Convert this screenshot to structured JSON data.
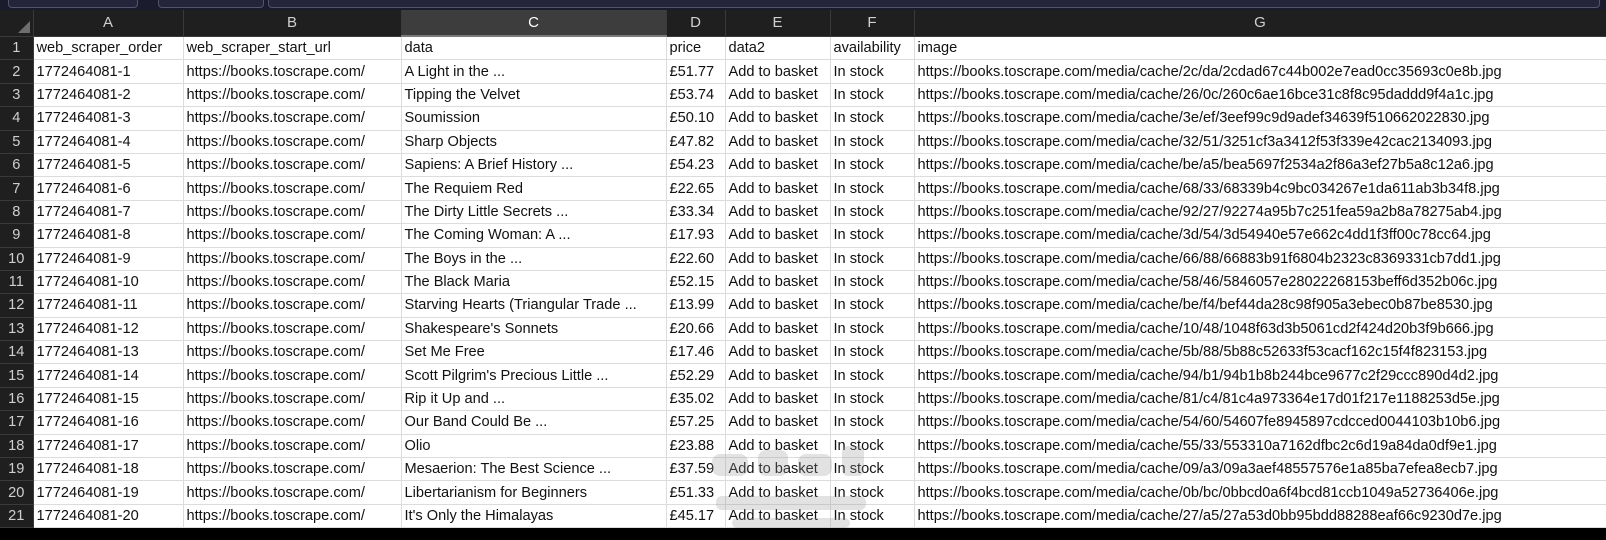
{
  "sheet": {
    "column_letters": [
      "A",
      "B",
      "C",
      "D",
      "E",
      "F",
      "G"
    ],
    "selected_column": "C",
    "header_row": {
      "number": "1",
      "cells": [
        "web_scraper_order",
        "web_scraper_start_url",
        "data",
        "price",
        "data2",
        "availability",
        "image"
      ]
    },
    "rows": [
      {
        "n": "2",
        "cells": [
          "1772464081-1",
          "https://books.toscrape.com/",
          "A Light in the ...",
          "£51.77",
          "Add to basket",
          "In stock",
          "https://books.toscrape.com/media/cache/2c/da/2cdad67c44b002e7ead0cc35693c0e8b.jpg"
        ]
      },
      {
        "n": "3",
        "cells": [
          "1772464081-2",
          "https://books.toscrape.com/",
          "Tipping the Velvet",
          "£53.74",
          "Add to basket",
          "In stock",
          "https://books.toscrape.com/media/cache/26/0c/260c6ae16bce31c8f8c95daddd9f4a1c.jpg"
        ]
      },
      {
        "n": "4",
        "cells": [
          "1772464081-3",
          "https://books.toscrape.com/",
          "Soumission",
          "£50.10",
          "Add to basket",
          "In stock",
          "https://books.toscrape.com/media/cache/3e/ef/3eef99c9d9adef34639f510662022830.jpg"
        ]
      },
      {
        "n": "5",
        "cells": [
          "1772464081-4",
          "https://books.toscrape.com/",
          "Sharp Objects",
          "£47.82",
          "Add to basket",
          "In stock",
          "https://books.toscrape.com/media/cache/32/51/3251cf3a3412f53f339e42cac2134093.jpg"
        ]
      },
      {
        "n": "6",
        "cells": [
          "1772464081-5",
          "https://books.toscrape.com/",
          "Sapiens: A Brief History ...",
          "£54.23",
          "Add to basket",
          "In stock",
          "https://books.toscrape.com/media/cache/be/a5/bea5697f2534a2f86a3ef27b5a8c12a6.jpg"
        ]
      },
      {
        "n": "7",
        "cells": [
          "1772464081-6",
          "https://books.toscrape.com/",
          "The Requiem Red",
          "£22.65",
          "Add to basket",
          "In stock",
          "https://books.toscrape.com/media/cache/68/33/68339b4c9bc034267e1da611ab3b34f8.jpg"
        ]
      },
      {
        "n": "8",
        "cells": [
          "1772464081-7",
          "https://books.toscrape.com/",
          "The Dirty Little Secrets ...",
          "£33.34",
          "Add to basket",
          "In stock",
          "https://books.toscrape.com/media/cache/92/27/92274a95b7c251fea59a2b8a78275ab4.jpg"
        ]
      },
      {
        "n": "9",
        "cells": [
          "1772464081-8",
          "https://books.toscrape.com/",
          "The Coming Woman: A ...",
          "£17.93",
          "Add to basket",
          "In stock",
          "https://books.toscrape.com/media/cache/3d/54/3d54940e57e662c4dd1f3ff00c78cc64.jpg"
        ]
      },
      {
        "n": "10",
        "cells": [
          "1772464081-9",
          "https://books.toscrape.com/",
          "The Boys in the ...",
          "£22.60",
          "Add to basket",
          "In stock",
          "https://books.toscrape.com/media/cache/66/88/66883b91f6804b2323c8369331cb7dd1.jpg"
        ]
      },
      {
        "n": "11",
        "cells": [
          "1772464081-10",
          "https://books.toscrape.com/",
          "The Black Maria",
          "£52.15",
          "Add to basket",
          "In stock",
          "https://books.toscrape.com/media/cache/58/46/5846057e28022268153beff6d352b06c.jpg"
        ]
      },
      {
        "n": "12",
        "cells": [
          "1772464081-11",
          "https://books.toscrape.com/",
          "Starving Hearts (Triangular Trade ...",
          "£13.99",
          "Add to basket",
          "In stock",
          "https://books.toscrape.com/media/cache/be/f4/bef44da28c98f905a3ebec0b87be8530.jpg"
        ]
      },
      {
        "n": "13",
        "cells": [
          "1772464081-12",
          "https://books.toscrape.com/",
          "Shakespeare's Sonnets",
          "£20.66",
          "Add to basket",
          "In stock",
          "https://books.toscrape.com/media/cache/10/48/1048f63d3b5061cd2f424d20b3f9b666.jpg"
        ]
      },
      {
        "n": "14",
        "cells": [
          "1772464081-13",
          "https://books.toscrape.com/",
          "Set Me Free",
          "£17.46",
          "Add to basket",
          "In stock",
          "https://books.toscrape.com/media/cache/5b/88/5b88c52633f53cacf162c15f4f823153.jpg"
        ]
      },
      {
        "n": "15",
        "cells": [
          "1772464081-14",
          "https://books.toscrape.com/",
          "Scott Pilgrim's Precious Little ...",
          "£52.29",
          "Add to basket",
          "In stock",
          "https://books.toscrape.com/media/cache/94/b1/94b1b8b244bce9677c2f29ccc890d4d2.jpg"
        ]
      },
      {
        "n": "16",
        "cells": [
          "1772464081-15",
          "https://books.toscrape.com/",
          "Rip it Up and ...",
          "£35.02",
          "Add to basket",
          "In stock",
          "https://books.toscrape.com/media/cache/81/c4/81c4a973364e17d01f217e1188253d5e.jpg"
        ]
      },
      {
        "n": "17",
        "cells": [
          "1772464081-16",
          "https://books.toscrape.com/",
          "Our Band Could Be ...",
          "£57.25",
          "Add to basket",
          "In stock",
          "https://books.toscrape.com/media/cache/54/60/54607fe8945897cdcced0044103b10b6.jpg"
        ]
      },
      {
        "n": "18",
        "cells": [
          "1772464081-17",
          "https://books.toscrape.com/",
          "Olio",
          "£23.88",
          "Add to basket",
          "In stock",
          "https://books.toscrape.com/media/cache/55/33/553310a7162dfbc2c6d19a84da0df9e1.jpg"
        ]
      },
      {
        "n": "19",
        "cells": [
          "1772464081-18",
          "https://books.toscrape.com/",
          "Mesaerion: The Best Science ...",
          "£37.59",
          "Add to basket",
          "In stock",
          "https://books.toscrape.com/media/cache/09/a3/09a3aef48557576e1a85ba7efea8ecb7.jpg"
        ]
      },
      {
        "n": "20",
        "cells": [
          "1772464081-19",
          "https://books.toscrape.com/",
          "Libertarianism for Beginners",
          "£51.33",
          "Add to basket",
          "In stock",
          "https://books.toscrape.com/media/cache/0b/bc/0bbcd0a6f4bcd81ccb1049a52736406e.jpg"
        ]
      },
      {
        "n": "21",
        "cells": [
          "1772464081-20",
          "https://books.toscrape.com/",
          "It's Only the Himalayas",
          "£45.17",
          "Add to basket",
          "In stock",
          "https://books.toscrape.com/media/cache/27/a5/27a53d0bb95bdd88288eaf66c9230d7e.jpg"
        ]
      }
    ]
  },
  "theme": {
    "header_bg": "#1f1f1f",
    "header_text": "#cfcfcf",
    "selected_header_bg": "#3d3d3d",
    "cell_bg": "#ffffff",
    "cell_text": "#111111",
    "gridline": "#dcdcdc"
  }
}
